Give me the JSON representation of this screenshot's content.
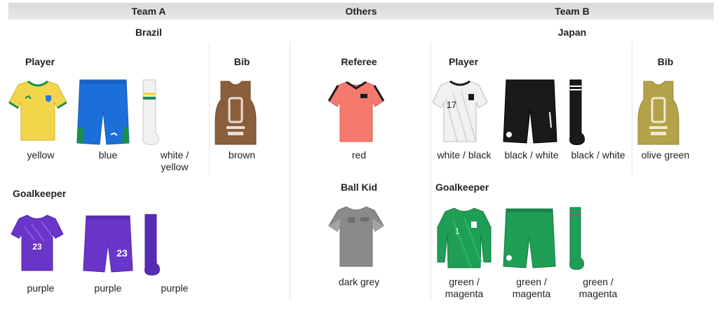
{
  "header": {
    "team_a": "Team A",
    "others": "Others",
    "team_b": "Team B"
  },
  "countries": {
    "team_a": "Brazil",
    "team_b": "Japan"
  },
  "sections": {
    "a_player": "Player",
    "a_bib": "Bib",
    "a_goalkeeper": "Goalkeeper",
    "referee": "Referee",
    "ball_kid": "Ball Kid",
    "b_player": "Player",
    "b_bib": "Bib",
    "b_goalkeeper": "Goalkeeper"
  },
  "captions": {
    "a_player_shirt": "yellow",
    "a_player_shorts": "blue",
    "a_player_socks_1": "white /",
    "a_player_socks_2": "yellow",
    "a_bib": "brown",
    "a_gk_shirt": "purple",
    "a_gk_shorts": "purple",
    "a_gk_socks": "purple",
    "referee": "red",
    "ball_kid": "dark grey",
    "b_player_shirt": "white / black",
    "b_player_shorts": "black / white",
    "b_player_socks": "black / white",
    "b_bib": "olive green",
    "b_gk_shirt_1": "green /",
    "b_gk_shirt_2": "magenta",
    "b_gk_shorts_1": "green /",
    "b_gk_shorts_2": "magenta",
    "b_gk_socks_1": "green /",
    "b_gk_socks_2": "magenta"
  },
  "jersey_numbers": {
    "b_player": "17",
    "a_gk": "23",
    "b_gk": "1"
  },
  "colors": {
    "yellow": "#f2d54a",
    "blue": "#1b6fd8",
    "white": "#f1f1f1",
    "brown": "#8b5e3c",
    "purple": "#6a35c9",
    "red": "#f47a6e",
    "dark_grey": "#8a8a8a",
    "black": "#1a1a1a",
    "olive": "#b3a247",
    "green": "#1f9e55",
    "magenta": "#d8348a"
  },
  "icons": [
    "shirt-icon",
    "shorts-icon",
    "socks-icon",
    "bib-icon"
  ]
}
